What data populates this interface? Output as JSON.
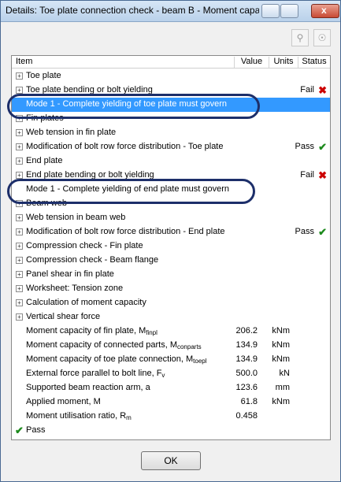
{
  "window": {
    "title": "Details: Toe plate connection check - beam B  - Moment capacity",
    "close_label": "x"
  },
  "toolbar": {
    "search_icon": "magnifier-icon",
    "pin_icon": "pin-icon"
  },
  "columns": {
    "item": "Item",
    "value": "Value",
    "units": "Units",
    "status": "Status"
  },
  "rows": [
    {
      "label": "Toe plate",
      "expand": "+"
    },
    {
      "label": "Toe plate bending or bolt yielding",
      "expand": "+",
      "status": "Fail",
      "status_icon": "✖"
    },
    {
      "label": "Mode 1 - Complete yielding of toe plate must govern"
    },
    {
      "label": "Fin plates",
      "expand": "+"
    },
    {
      "label": "Web tension in fin plate",
      "expand": "+"
    },
    {
      "label": "Modification of bolt row force distribution - Toe plate",
      "expand": "+",
      "status": "Pass",
      "status_icon": "✔"
    },
    {
      "label": "End plate",
      "expand": "+"
    },
    {
      "label": "End plate bending or bolt yielding",
      "expand": "+",
      "status": "Fail",
      "status_icon": "✖"
    },
    {
      "label": "Mode 1 - Complete yielding of end plate must govern"
    },
    {
      "label": "Beam web",
      "expand": "+"
    },
    {
      "label": "Web tension in beam web",
      "expand": "+"
    },
    {
      "label": "Modification of bolt row force distribution - End plate",
      "expand": "+",
      "status": "Pass",
      "status_icon": "✔"
    },
    {
      "label": "Compression check - Fin plate",
      "expand": "+"
    },
    {
      "label": "Compression check - Beam flange",
      "expand": "+"
    },
    {
      "label": "Panel shear in fin plate",
      "expand": "+"
    },
    {
      "label": "Worksheet: Tension zone",
      "expand": "+"
    },
    {
      "label": "Calculation of moment capacity",
      "expand": "+"
    },
    {
      "label": "Vertical shear force",
      "expand": "+"
    },
    {
      "label": "Moment capacity of fin plate, M",
      "sub": "finpl",
      "value": "206.2",
      "unit": "kNm"
    },
    {
      "label": "Moment capacity of connected parts, M",
      "sub": "conparts",
      "value": "134.9",
      "unit": "kNm"
    },
    {
      "label": "Moment capacity of toe plate connection, M",
      "sub": "toepl",
      "value": "134.9",
      "unit": "kNm"
    },
    {
      "label": "External force parallel to bolt line, F",
      "sub": "v",
      "value": "500.0",
      "unit": "kN"
    },
    {
      "label": "Supported beam reaction arm, a",
      "value": "123.6",
      "unit": "mm"
    },
    {
      "label": "Applied moment, M",
      "value": "61.8",
      "unit": "kNm"
    },
    {
      "label": "Moment utilisation ratio, R",
      "sub": "m",
      "value": "0.458"
    },
    {
      "label": "Pass",
      "status_icon": "✔"
    }
  ],
  "ok_label": "OK",
  "colors": {
    "selection": "#3399ff",
    "fail": "#cc0000",
    "pass": "#1d8a1d",
    "highlight_oval": "#1d2f6a"
  }
}
